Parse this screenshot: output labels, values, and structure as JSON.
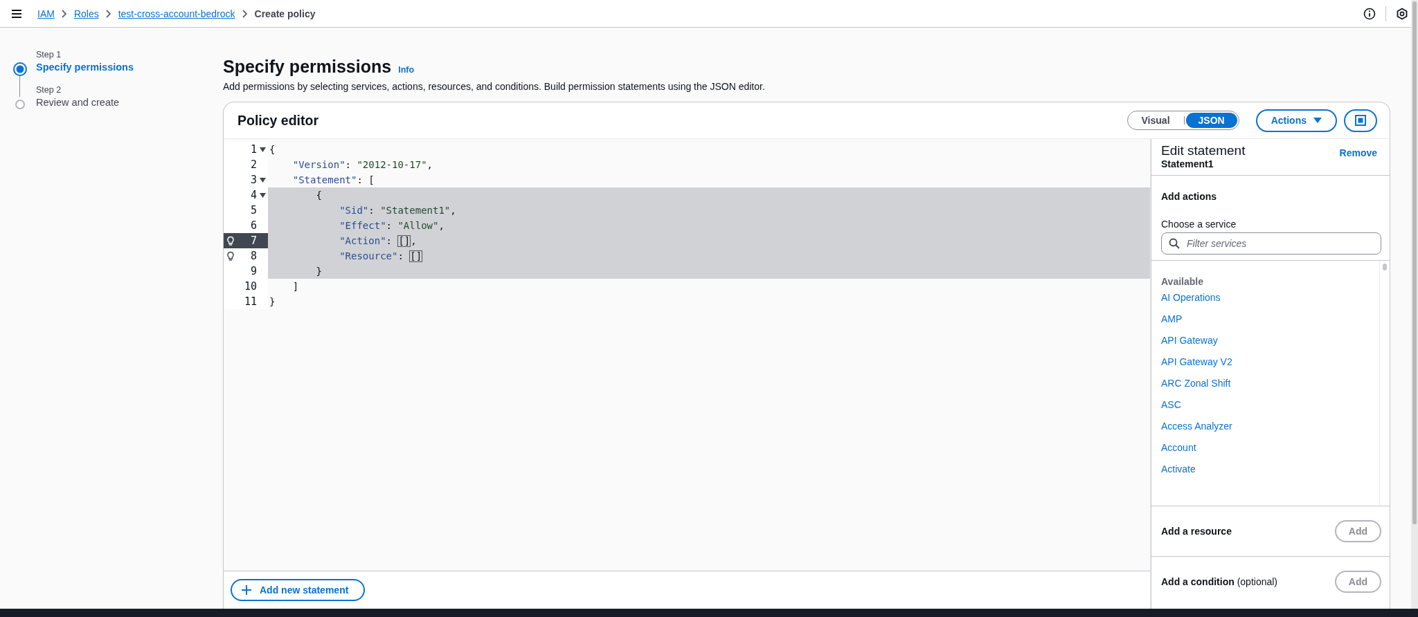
{
  "breadcrumb": [
    {
      "label": "IAM",
      "kind": "link"
    },
    {
      "label": "Roles",
      "kind": "link"
    },
    {
      "label": "test-cross-account-bedrock",
      "kind": "link"
    },
    {
      "label": "Create policy",
      "kind": "current"
    }
  ],
  "steps": [
    {
      "step_label": "Step 1",
      "title": "Specify permissions",
      "selected": true
    },
    {
      "step_label": "Step 2",
      "title": "Review and create",
      "selected": false
    }
  ],
  "page": {
    "title": "Specify permissions",
    "info": "Info",
    "description": "Add permissions by selecting services, actions, resources, and conditions. Build permission statements using the JSON editor."
  },
  "editor": {
    "title": "Policy editor",
    "modes": [
      {
        "label": "Visual",
        "selected": false
      },
      {
        "label": "JSON",
        "selected": true
      }
    ],
    "actions_button": "Actions",
    "lines": [
      {
        "number": "1",
        "foldable": true,
        "hint": false,
        "active": false,
        "selected": false,
        "tokens": [
          {
            "kind": "punct",
            "text": "{"
          }
        ]
      },
      {
        "number": "2",
        "foldable": false,
        "hint": false,
        "active": false,
        "selected": false,
        "tokens": [
          {
            "kind": "key",
            "text": "    \"Version\""
          },
          {
            "kind": "punct",
            "text": ": "
          },
          {
            "kind": "str",
            "text": "\"2012-10-17\""
          },
          {
            "kind": "punct",
            "text": ","
          }
        ]
      },
      {
        "number": "3",
        "foldable": true,
        "hint": false,
        "active": false,
        "selected": false,
        "tokens": [
          {
            "kind": "key",
            "text": "    \"Statement\""
          },
          {
            "kind": "punct",
            "text": ": ["
          }
        ]
      },
      {
        "number": "4",
        "foldable": true,
        "hint": false,
        "active": false,
        "selected": true,
        "tokens": [
          {
            "kind": "punct",
            "text": "        {"
          }
        ]
      },
      {
        "number": "5",
        "foldable": false,
        "hint": false,
        "active": false,
        "selected": true,
        "tokens": [
          {
            "kind": "key",
            "text": "            \"Sid\""
          },
          {
            "kind": "punct",
            "text": ": "
          },
          {
            "kind": "str",
            "text": "\"Statement1\""
          },
          {
            "kind": "punct",
            "text": ","
          }
        ]
      },
      {
        "number": "6",
        "foldable": false,
        "hint": false,
        "active": false,
        "selected": true,
        "tokens": [
          {
            "kind": "key",
            "text": "            \"Effect\""
          },
          {
            "kind": "punct",
            "text": ": "
          },
          {
            "kind": "str",
            "text": "\"Allow\""
          },
          {
            "kind": "punct",
            "text": ","
          }
        ]
      },
      {
        "number": "7",
        "foldable": false,
        "hint": true,
        "active": true,
        "selected": true,
        "tokens": [
          {
            "kind": "key",
            "text": "            \"Action\""
          },
          {
            "kind": "punct",
            "text": ": "
          },
          {
            "kind": "bracket",
            "text": "[]"
          },
          {
            "kind": "punct",
            "text": ","
          }
        ]
      },
      {
        "number": "8",
        "foldable": false,
        "hint": true,
        "active": false,
        "selected": true,
        "tokens": [
          {
            "kind": "key",
            "text": "            \"Resource\""
          },
          {
            "kind": "punct",
            "text": ": "
          },
          {
            "kind": "bracket",
            "text": "[]"
          }
        ]
      },
      {
        "number": "9",
        "foldable": false,
        "hint": false,
        "active": false,
        "selected": true,
        "tokens": [
          {
            "kind": "punct",
            "text": "        }"
          }
        ]
      },
      {
        "number": "10",
        "foldable": false,
        "hint": false,
        "active": false,
        "selected": false,
        "tokens": [
          {
            "kind": "punct",
            "text": "    ]"
          }
        ]
      },
      {
        "number": "11",
        "foldable": false,
        "hint": false,
        "active": false,
        "selected": false,
        "tokens": [
          {
            "kind": "punct",
            "text": "}"
          }
        ]
      }
    ],
    "add_statement": "Add new statement"
  },
  "panel": {
    "title": "Edit statement",
    "subtitle": "Statement1",
    "remove": "Remove",
    "add_actions": "Add actions",
    "service_label": "Choose a service",
    "filter_placeholder": "Filter services",
    "available": "Available",
    "services": [
      "AI Operations",
      "AMP",
      "API Gateway",
      "API Gateway V2",
      "ARC Zonal Shift",
      "ASC",
      "Access Analyzer",
      "Account",
      "Activate"
    ],
    "sections": [
      {
        "title": "Add a resource",
        "button": "Add",
        "disabled": true
      },
      {
        "title": "Add a condition",
        "note": "(optional)",
        "button": "Add",
        "disabled": true
      }
    ]
  }
}
